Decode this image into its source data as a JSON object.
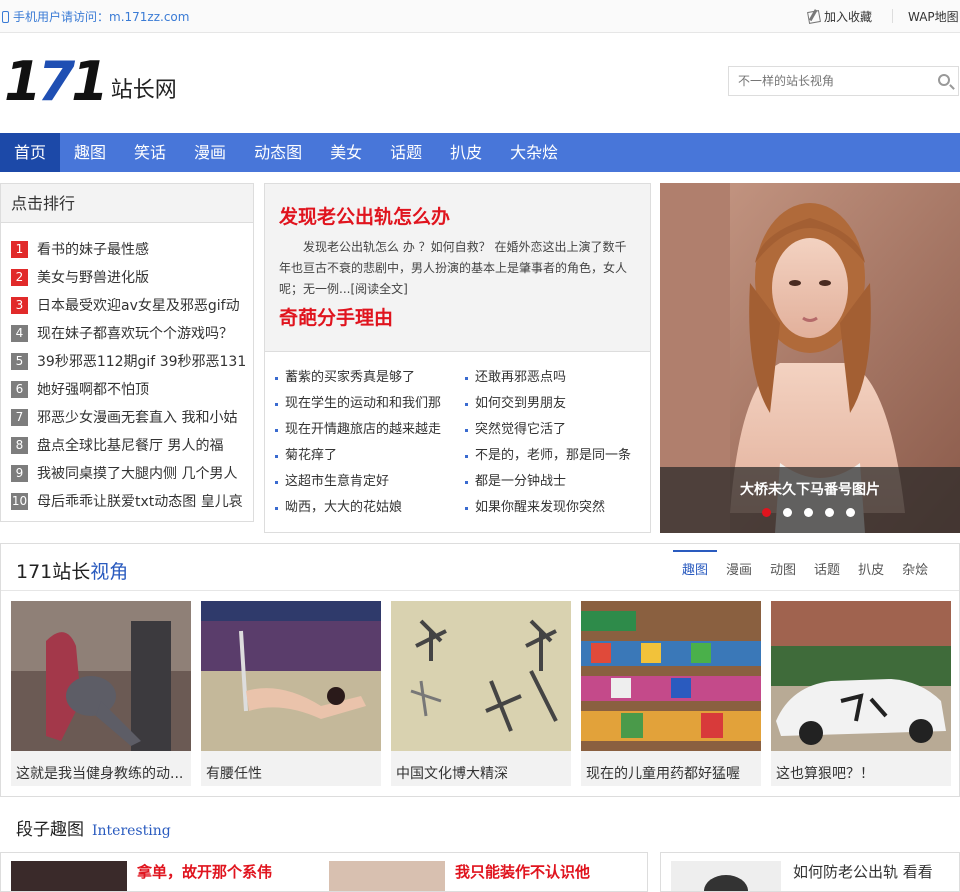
{
  "topbar": {
    "mobile_text": "手机用户请访问：m.171zz.com",
    "favorite_label": "加入收藏",
    "wap_label": "WAP地图"
  },
  "logo": {
    "num": "171",
    "text": "站长网"
  },
  "search": {
    "placeholder": "不一样的站长视角"
  },
  "nav": [
    "首页",
    "趣图",
    "笑话",
    "漫画",
    "动态图",
    "美女",
    "话题",
    "扒皮",
    "大杂烩"
  ],
  "rank": {
    "title": "点击排行",
    "items": [
      {
        "n": "1",
        "t": "看书的妹子最性感"
      },
      {
        "n": "2",
        "t": "美女与野兽进化版"
      },
      {
        "n": "3",
        "t": "日本最受欢迎av女星及邪恶gif动"
      },
      {
        "n": "4",
        "t": "现在妹子都喜欢玩个个游戏吗？"
      },
      {
        "n": "5",
        "t": "39秒邪恶112期gif 39秒邪恶131"
      },
      {
        "n": "6",
        "t": "她好强啊都不怕顶"
      },
      {
        "n": "7",
        "t": "邪恶少女漫画无套直入 我和小姑"
      },
      {
        "n": "8",
        "t": "盘点全球比基尼餐厅 男人的福"
      },
      {
        "n": "9",
        "t": "我被同桌摸了大腿内侧 几个男人"
      },
      {
        "n": "10",
        "t": "母后乖乖让朕爱txt动态图 皇儿哀"
      }
    ]
  },
  "feature": {
    "headline1": "发现老公出轨怎么办",
    "summary": "发现老公出轨怎么 办 ？如何自救？ 在婚外恋这出上演了数千年也亘古不衰的悲剧中，男人扮演的基本上是肇事者的角色，女人呢；无一例...[阅读全文]",
    "headline2": "奇葩分手理由",
    "links": [
      "蓄紫的买家秀真是够了",
      "还敢再邪恶点吗",
      "现在学生的运动和和我们那",
      "如何交到男朋友",
      "现在开情趣旅店的越来越走",
      "突然觉得它活了",
      "菊花痒了",
      "不是的，老师，那是同一条",
      "这超市生意肯定好",
      "都是一分钟战士",
      "呦西，大大的花姑娘",
      "如果你醒来发现你突然"
    ]
  },
  "slider": {
    "caption": "大桥未久下马番号图片",
    "dot_count": 5,
    "active_dot": 1
  },
  "view": {
    "title_a": "171站长",
    "title_b": "视角",
    "tabs": [
      "趣图",
      "漫画",
      "动图",
      "话题",
      "扒皮",
      "杂烩"
    ],
    "cards": [
      {
        "caption": "这就是我当健身教练的动..."
      },
      {
        "caption": "有腰任性"
      },
      {
        "caption": "中国文化博大精深"
      },
      {
        "caption": "现在的儿童用药都好猛喔"
      },
      {
        "caption": "这也算狠吧？！"
      }
    ]
  },
  "joke": {
    "title": "段子趣图",
    "subtitle": "Interesting",
    "item1": "拿单，故开那个系伟",
    "item2": "我只能装作不认识他",
    "item3": "如何防老公出轨 看看"
  },
  "colors": {
    "nav": "#4876d9",
    "nav_active": "#1c49a8",
    "accent_red": "#e0141e",
    "link_blue": "#2a5bbf"
  }
}
